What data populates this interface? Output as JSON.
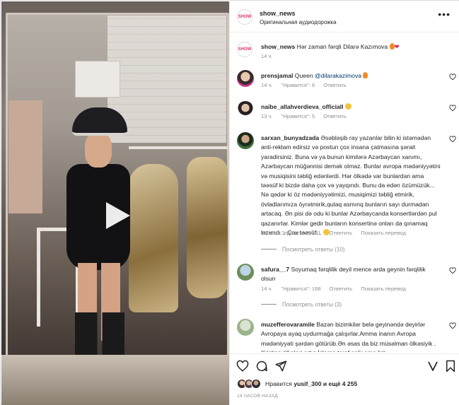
{
  "post": {
    "username": "show_news",
    "audio": "Оригинальная аудиодорожка",
    "avatar_text": "SHOW",
    "caption_user": "show_news",
    "caption_text": "Hər zaman fərqli Dilarə Kazımova",
    "caption_time": "14 ч."
  },
  "comments": [
    {
      "user": "prensjamal",
      "text": "Queen",
      "mention": "@dilarakazimova",
      "time": "14 ч.",
      "likes": "\"Нравится\": 6",
      "reply": "Ответить"
    },
    {
      "user": "naibe_allahverdieva_officiall",
      "text": "",
      "time": "13 ч.",
      "likes": "\"Нравится\": 5",
      "reply": "Ответить"
    },
    {
      "user": "sarxan_bunyadzada",
      "text": "Əsəbləşib ray yazanlar bilin ki istəmədən anti-reklam edirsiz və postun çox insana çatmasına şərait yaradirsiniz. Buna və ya bunun kimilərə Azərbaycan xanımı, Azərbaycan müğənnisi demək olmaz. Bunlar avropa mədəniyyətini və musiqisini təbliğ edənlərdi. Hər ölkədə var bunlardan ama təəsüf ki bizdə daha çox və yayqındı. Bunu da edən özümüzük... Nə qədər ki öz mədəniyyətimizi, musiqimizi təbliğ etmirik, övladlarımıza öyrətmirik,qulaq asmınq bunların sayı durmadan artacaq. Ən pisi də odu ki bunlar Azərbaycanda konsertlərdən pul qazanırlar. Kimlər gedir bunların konsertinə onları da qınamaq lazımdı... Çox təəsüf...",
      "time": "13 ч.",
      "likes": "\"Нравится\": 291",
      "reply": "Ответить",
      "translate": "Показать перевод",
      "replies": "Посмотреть ответы (10)"
    },
    {
      "user": "safura__7",
      "text": "Soyumaq fərqlilik deyil mence arda geynin fərqlilik olsun",
      "time": "14 ч.",
      "likes": "\"Нравится\": 168",
      "reply": "Ответить",
      "translate": "Показать перевод",
      "replies": "Посмотреть ответы (3)"
    },
    {
      "user": "muzefferovaramile",
      "text": "Bazən bizimkilər belə geyinəndə deyirlər Avropaya ayaq uydurmağa çalışırlar.Amma inanın Avropa mədəniyyəti şərdən götürüb.Ən əsas da biz müsəlman ölkəsiyik . Xristian ölkələri artıq İslama tərəf gəlir ama biz",
      "time": "",
      "likes": "",
      "reply": ""
    }
  ],
  "likes_line": {
    "prefix": "Нравится",
    "user": "yusif_300",
    "suffix": "и ещё 4 255"
  },
  "timestamp": "14 ЧАСОВ НАЗАД",
  "colors": {
    "text": "#262626",
    "muted": "#8e8e8e",
    "link": "#00376b",
    "border": "#dbdbdb"
  }
}
